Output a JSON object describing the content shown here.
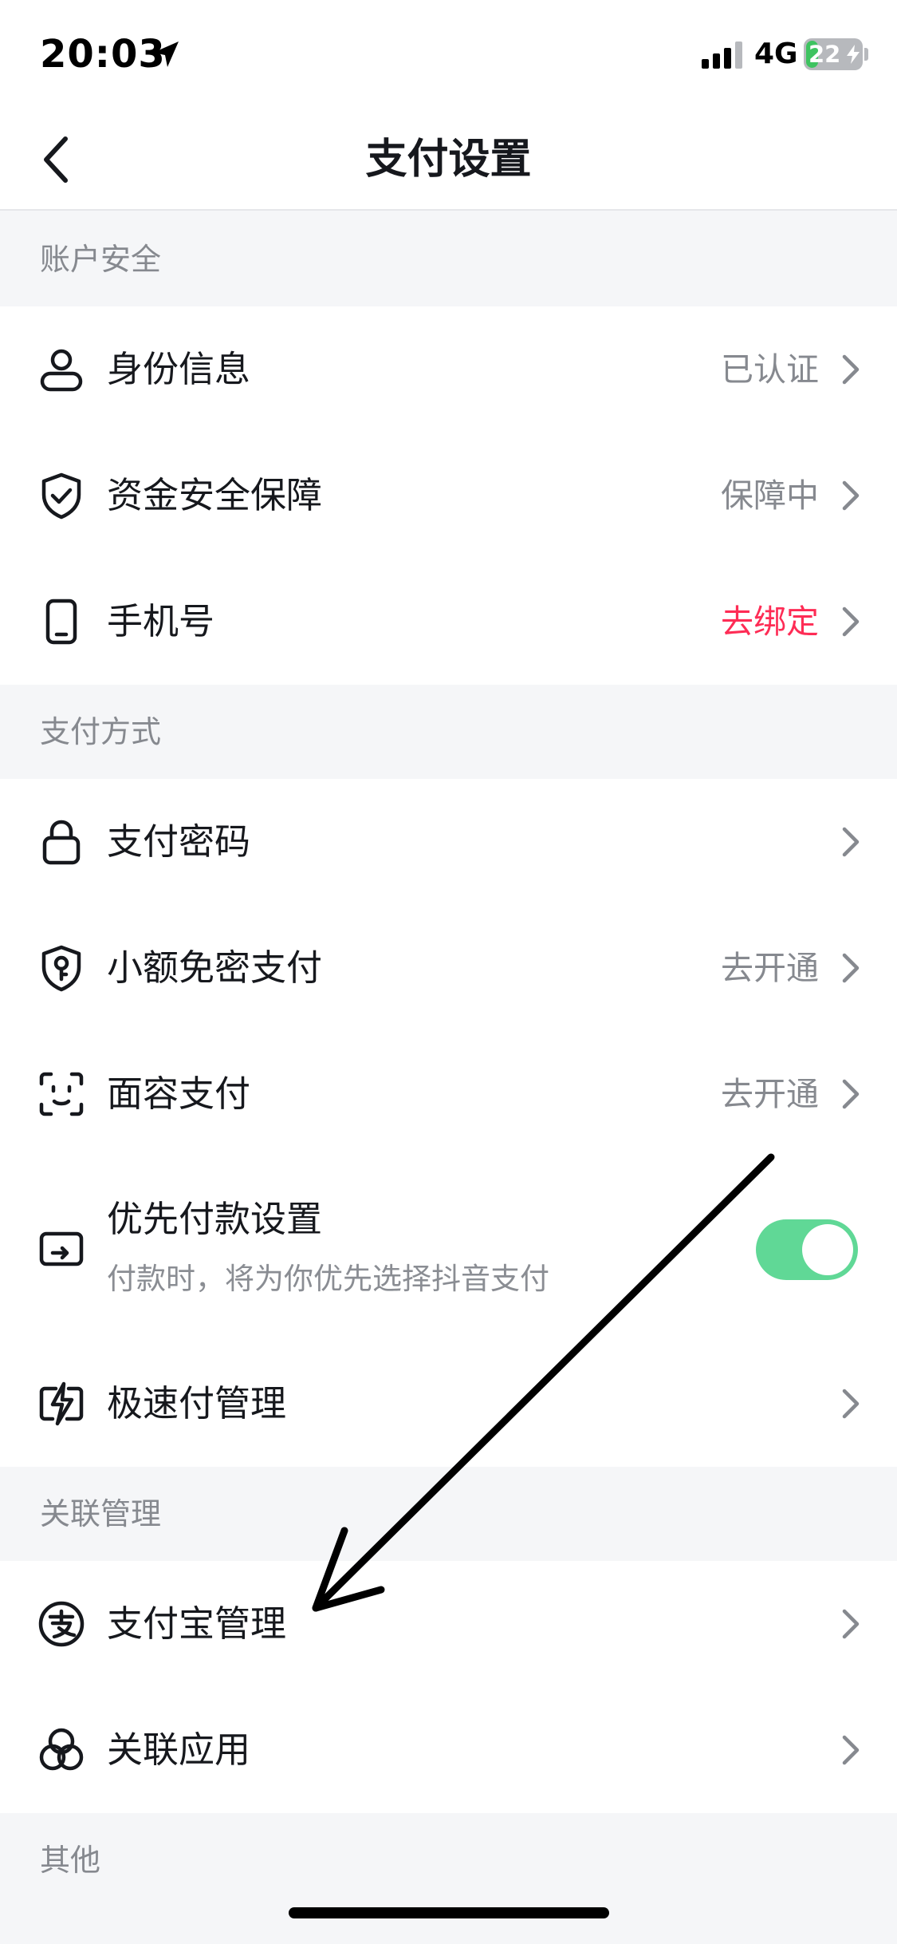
{
  "status_bar": {
    "time": "20:03",
    "network": "4G",
    "battery_level": "22",
    "battery_fraction": 0.22,
    "icons": [
      "location-arrow-icon",
      "signal-bars-icon",
      "battery-charging-icon"
    ]
  },
  "nav": {
    "title": "支付设置",
    "back_icon": "chevron-left-icon"
  },
  "sections": {
    "account_security": "账户安全",
    "payment_methods": "支付方式",
    "linked_management": "关联管理",
    "other": "其他"
  },
  "account_security": {
    "identity": {
      "label": "身份信息",
      "value": "已认证",
      "icon": "person-icon"
    },
    "fund_safety": {
      "label": "资金安全保障",
      "value": "保障中",
      "icon": "shield-check-icon"
    },
    "phone": {
      "label": "手机号",
      "value": "去绑定",
      "icon": "phone-icon"
    }
  },
  "payment_methods": {
    "password": {
      "label": "支付密码",
      "icon": "lock-icon"
    },
    "small_free": {
      "label": "小额免密支付",
      "value": "去开通",
      "icon": "shield-key-icon"
    },
    "face_pay": {
      "label": "面容支付",
      "value": "去开通",
      "icon": "face-id-icon"
    },
    "priority": {
      "label": "优先付款设置",
      "subtitle": "付款时，将为你优先选择抖音支付",
      "toggle_on": true,
      "icon": "card-arrow-icon"
    },
    "express": {
      "label": "极速付管理",
      "icon": "lightning-card-icon"
    }
  },
  "linked": {
    "alipay": {
      "label": "支付宝管理",
      "icon": "alipay-icon"
    },
    "apps": {
      "label": "关联应用",
      "icon": "linked-circles-icon"
    }
  },
  "colors": {
    "alert": "#fe2c55",
    "toggle_on": "#60d896",
    "text_primary": "#16181d",
    "text_secondary": "#86898f",
    "background": "#f5f6f8"
  }
}
